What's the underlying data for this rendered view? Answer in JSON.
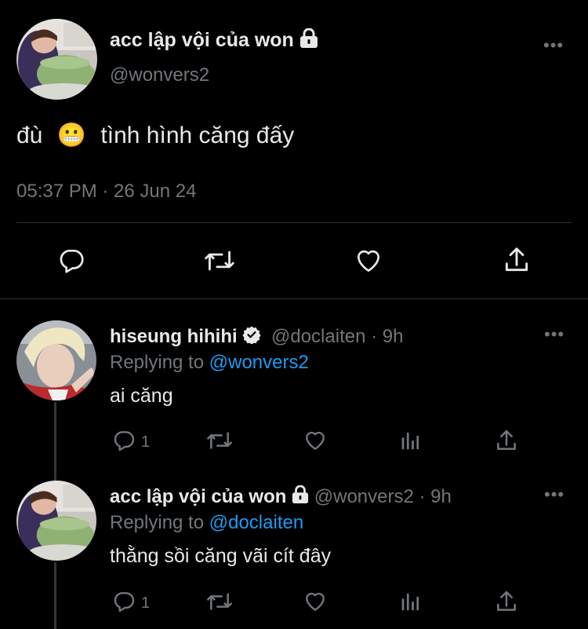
{
  "main_tweet": {
    "display_name": "acc lập vội của won",
    "handle": "@wonvers2",
    "text_before": "đù",
    "emoji": "😬",
    "text_after": "tình hình căng đấy",
    "timestamp": "05:37 PM · 26 Jun 24"
  },
  "replies": [
    {
      "display_name": "hiseung hihihi",
      "handle": "@doclaiten",
      "time": "· 9h",
      "replying_prefix": "Replying to",
      "replying_to": "@wonvers2",
      "text": "ai căng",
      "reply_count": "1"
    },
    {
      "display_name": "acc lập vội của won",
      "handle": "@wonvers2",
      "time": "· 9h",
      "replying_prefix": "Replying to",
      "replying_to": "@doclaiten",
      "text": "thằng sồi căng vãi cít đây",
      "reply_count": "1"
    }
  ],
  "more_glyph": "•••",
  "colors": {
    "background": "#000000",
    "text": "#e7e9ea",
    "muted": "#71767b",
    "link": "#1d9bf0"
  }
}
